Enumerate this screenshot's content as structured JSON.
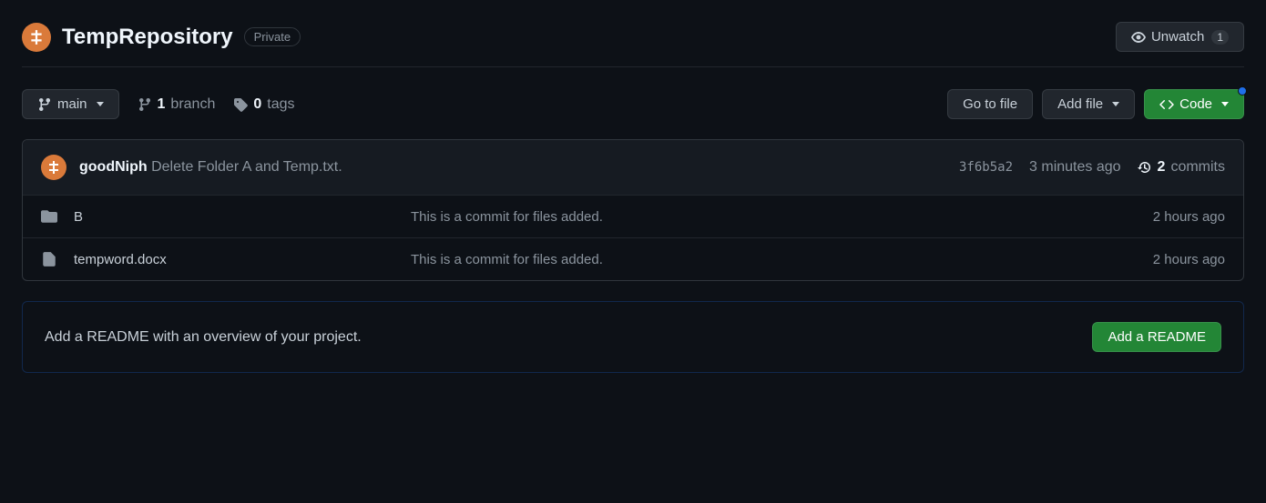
{
  "repo": {
    "name": "TempRepository",
    "visibility": "Private"
  },
  "watch": {
    "label": "Unwatch",
    "count": "1"
  },
  "branchSelector": {
    "label": "main"
  },
  "stats": {
    "branches": {
      "count": "1",
      "label": "branch"
    },
    "tags": {
      "count": "0",
      "label": "tags"
    }
  },
  "actions": {
    "goToFile": "Go to file",
    "addFile": "Add file",
    "code": "Code"
  },
  "latestCommit": {
    "author": "goodNiph",
    "message": "Delete Folder A and Temp.txt.",
    "hash": "3f6b5a2",
    "time": "3 minutes ago",
    "commitsCount": "2",
    "commitsLabel": "commits"
  },
  "files": [
    {
      "type": "folder",
      "name": "B",
      "message": "This is a commit for files added.",
      "time": "2 hours ago"
    },
    {
      "type": "file",
      "name": "tempword.docx",
      "message": "This is a commit for files added.",
      "time": "2 hours ago"
    }
  ],
  "readmePrompt": {
    "text": "Add a README with an overview of your project.",
    "button": "Add a README"
  }
}
